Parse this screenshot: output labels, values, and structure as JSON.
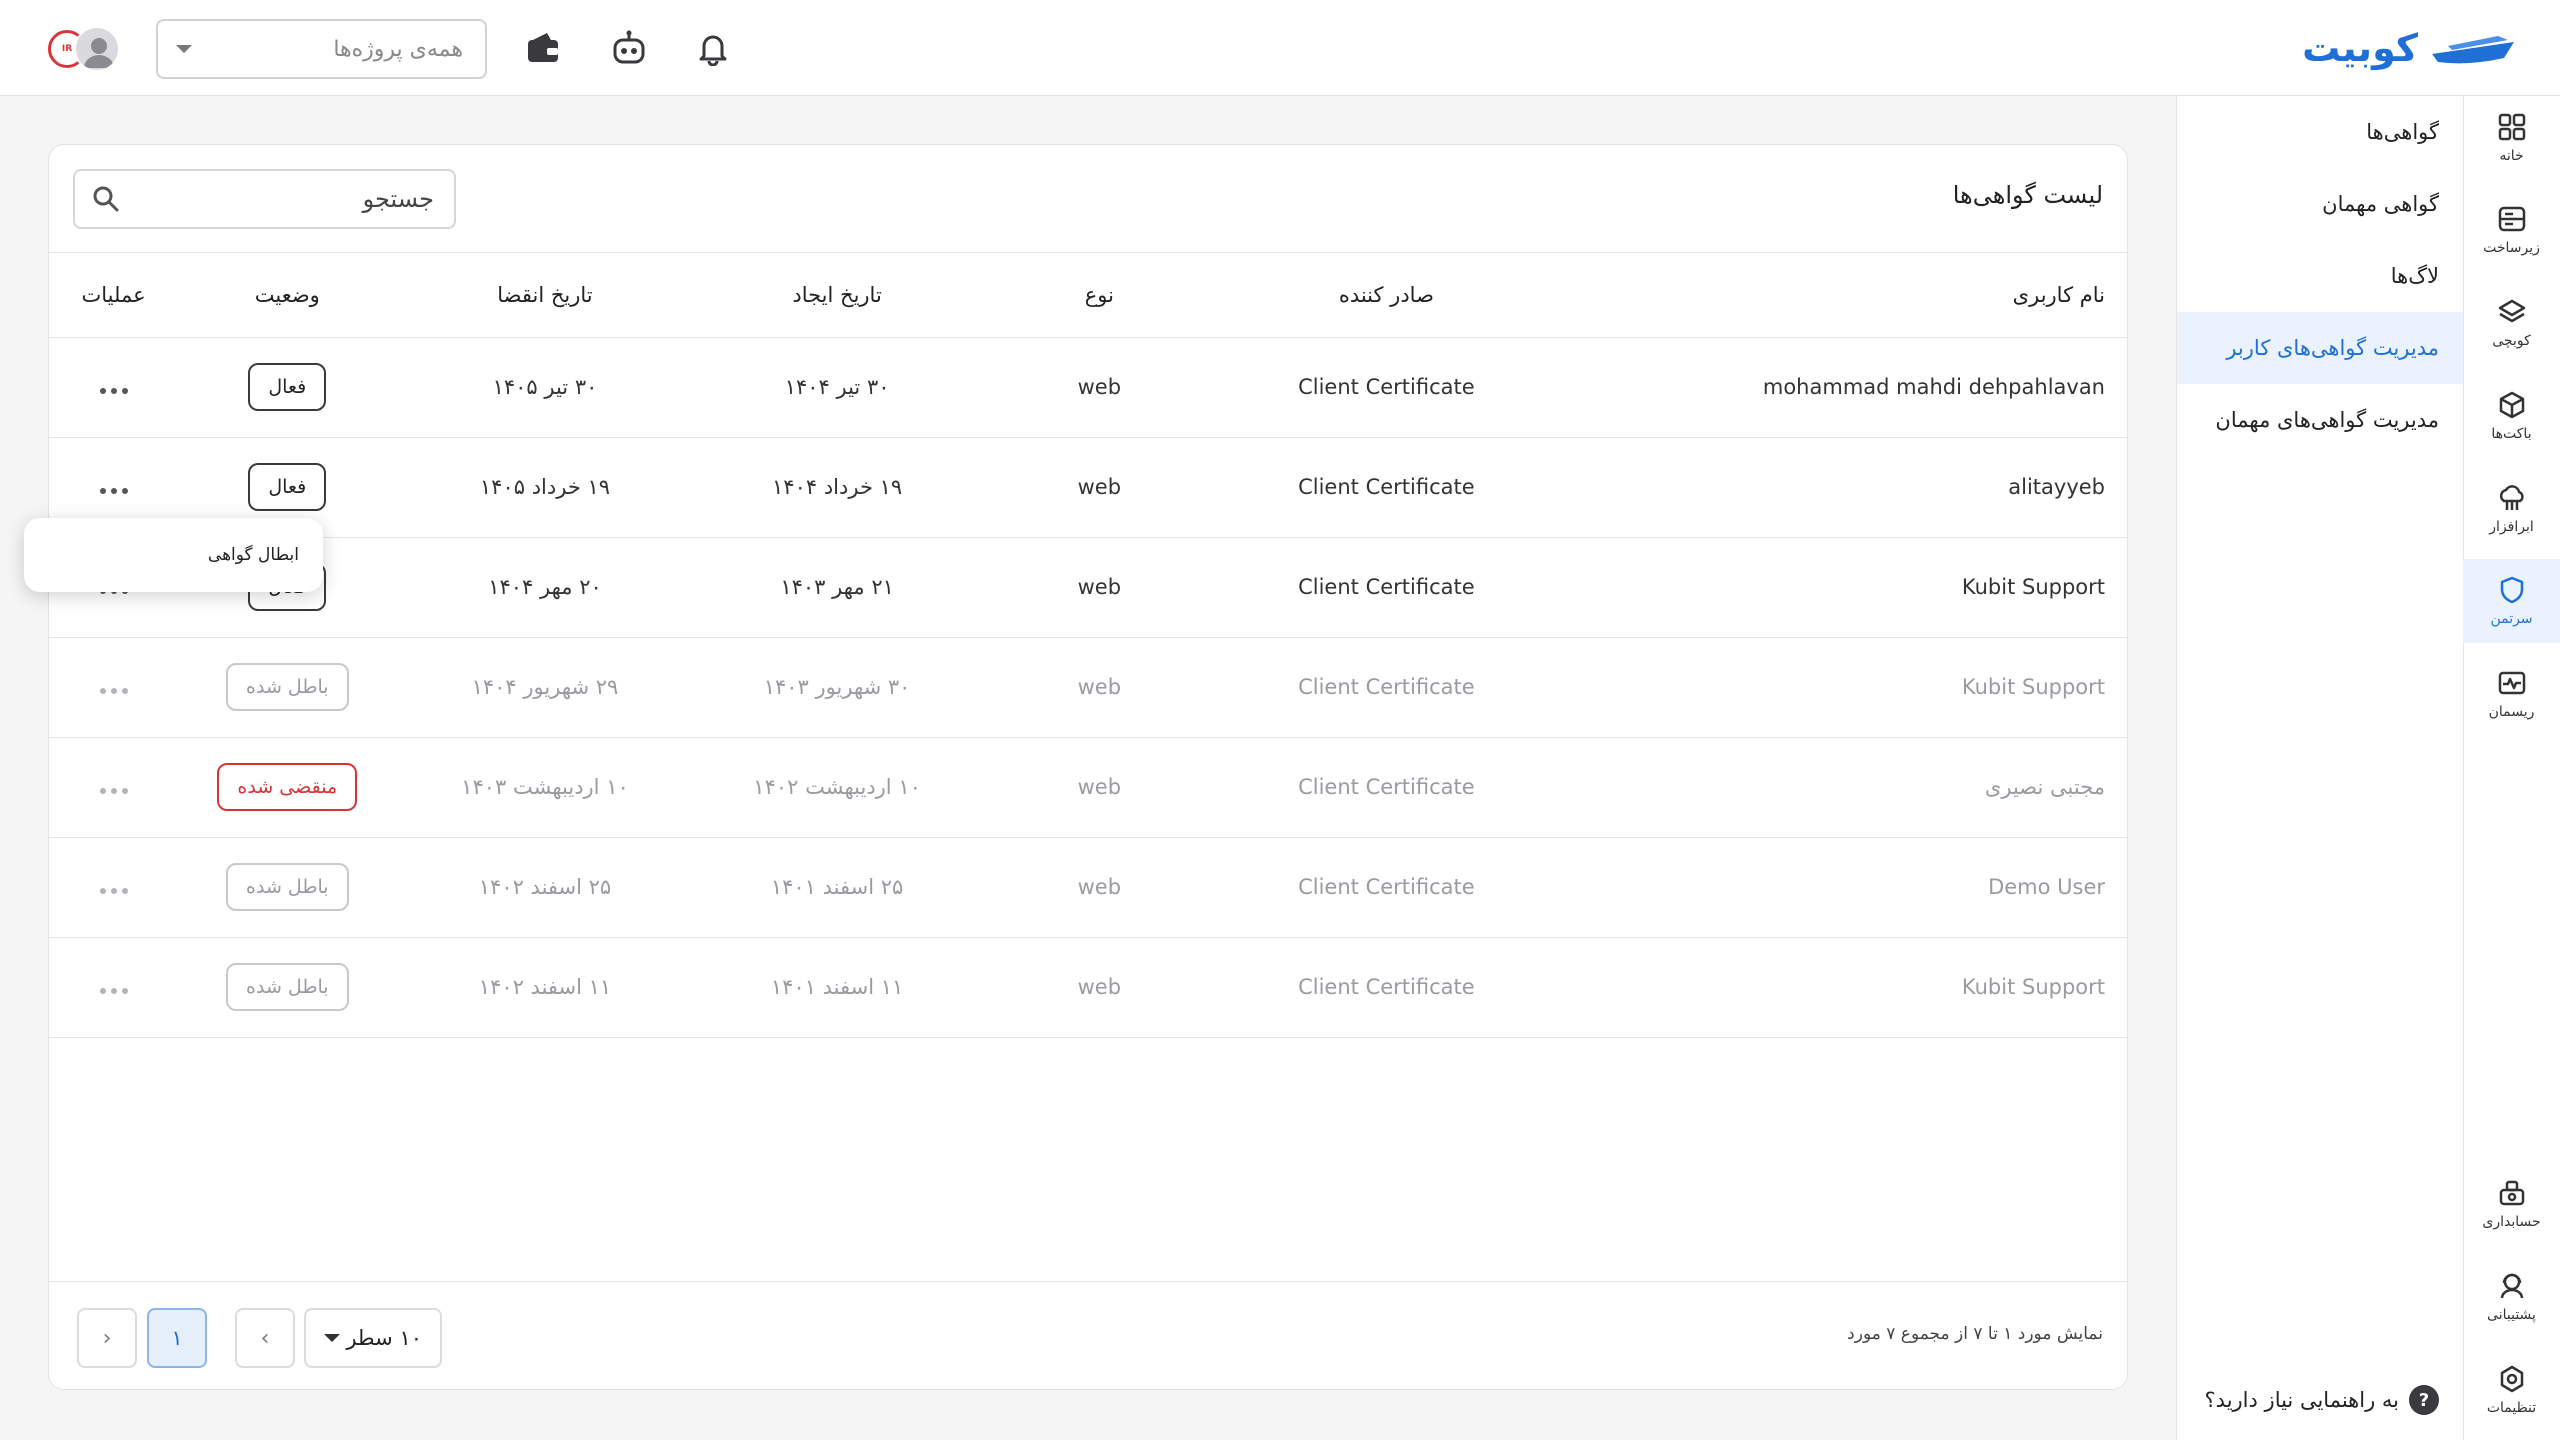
{
  "brand": {
    "name": "کوبیت",
    "color": "#1f6fd6"
  },
  "topbar": {
    "project_select_placeholder": "همه‌ی پروژه‌ها",
    "icons": [
      "bell-icon",
      "robot-icon",
      "wallet-icon",
      "user-avatar-icon"
    ]
  },
  "rail": {
    "items": [
      {
        "label": "خانه",
        "icon": "grid-icon",
        "active": false
      },
      {
        "label": "زیرساخت",
        "icon": "server-icon",
        "active": false
      },
      {
        "label": "کوبچی",
        "icon": "layers-icon",
        "active": false
      },
      {
        "label": "باکت‌ها",
        "icon": "cube-icon",
        "active": false
      },
      {
        "label": "ابرافزار",
        "icon": "cloud-app-icon",
        "active": false
      },
      {
        "label": "سرتمن",
        "icon": "shield-icon",
        "active": true
      },
      {
        "label": "ریسمان",
        "icon": "monitor-pulse-icon",
        "active": false
      }
    ],
    "bottom_items": [
      {
        "label": "حسابداری",
        "icon": "accounting-icon"
      },
      {
        "label": "پشتیبانی",
        "icon": "support-icon"
      },
      {
        "label": "تنظیمات",
        "icon": "settings-icon"
      }
    ]
  },
  "subnav": {
    "items": [
      {
        "label": "گواهی‌ها",
        "active": false
      },
      {
        "label": "گواهی مهمان",
        "active": false
      },
      {
        "label": "لاگ‌ها",
        "active": false
      },
      {
        "label": "مدیریت گواهی‌های کاربر",
        "active": true
      },
      {
        "label": "مدیریت گواهی‌های مهمان",
        "active": false
      }
    ],
    "help_label": "به راهنمایی نیاز دارید؟",
    "help_icon": "?"
  },
  "main": {
    "title": "لیست گواهی‌ها",
    "search_placeholder": "جستجو",
    "columns": {
      "user": "نام کاربری",
      "issuer": "صادر کننده",
      "type": "نوع",
      "created": "تاریخ ایجاد",
      "expire": "تاریخ انقضا",
      "status": "وضعیت",
      "ops": "عملیات"
    },
    "rows": [
      {
        "user": "mohammad mahdi dehpahlavan",
        "issuer": "Client Certificate",
        "type": "web",
        "created": "۳۰ تیر ۱۴۰۴",
        "expire": "۳۰ تیر ۱۴۰۵",
        "status": "فعال",
        "state": "active"
      },
      {
        "user": "alitayyeb",
        "issuer": "Client Certificate",
        "type": "web",
        "created": "۱۹ خرداد ۱۴۰۴",
        "expire": "۱۹ خرداد ۱۴۰۵",
        "status": "فعال",
        "state": "active"
      },
      {
        "user": "Kubit Support",
        "issuer": "Client Certificate",
        "type": "web",
        "created": "۲۱ مهر ۱۴۰۳",
        "expire": "۲۰ مهر ۱۴۰۴",
        "status": "فعال",
        "state": "active"
      },
      {
        "user": "Kubit Support",
        "issuer": "Client Certificate",
        "type": "web",
        "created": "۳۰ شهریور ۱۴۰۳",
        "expire": "۲۹ شهریور ۱۴۰۴",
        "status": "باطل شده",
        "state": "revoked"
      },
      {
        "user": "مجتبی نصیری",
        "issuer": "Client Certificate",
        "type": "web",
        "created": "۱۰ اردیبهشت ۱۴۰۲",
        "expire": "۱۰ اردیبهشت ۱۴۰۳",
        "status": "منقضی شده",
        "state": "expired"
      },
      {
        "user": "Demo User",
        "issuer": "Client Certificate",
        "type": "web",
        "created": "۲۵ اسفند ۱۴۰۱",
        "expire": "۲۵ اسفند ۱۴۰۲",
        "status": "باطل شده",
        "state": "revoked"
      },
      {
        "user": "Kubit Support",
        "issuer": "Client Certificate",
        "type": "web",
        "created": "۱۱ اسفند ۱۴۰۱",
        "expire": "۱۱ اسفند ۱۴۰۲",
        "status": "باطل شده",
        "state": "revoked"
      }
    ],
    "popup_menu": {
      "items": [
        "ابطال گواهی"
      ]
    }
  },
  "footer": {
    "summary": "نمایش مورد ۱ تا ۷ از مجموع ۷ مورد",
    "rows_per_page": "۱۰ سطر",
    "current_page": "۱",
    "prev_glyph": "‹",
    "next_glyph": "›"
  }
}
